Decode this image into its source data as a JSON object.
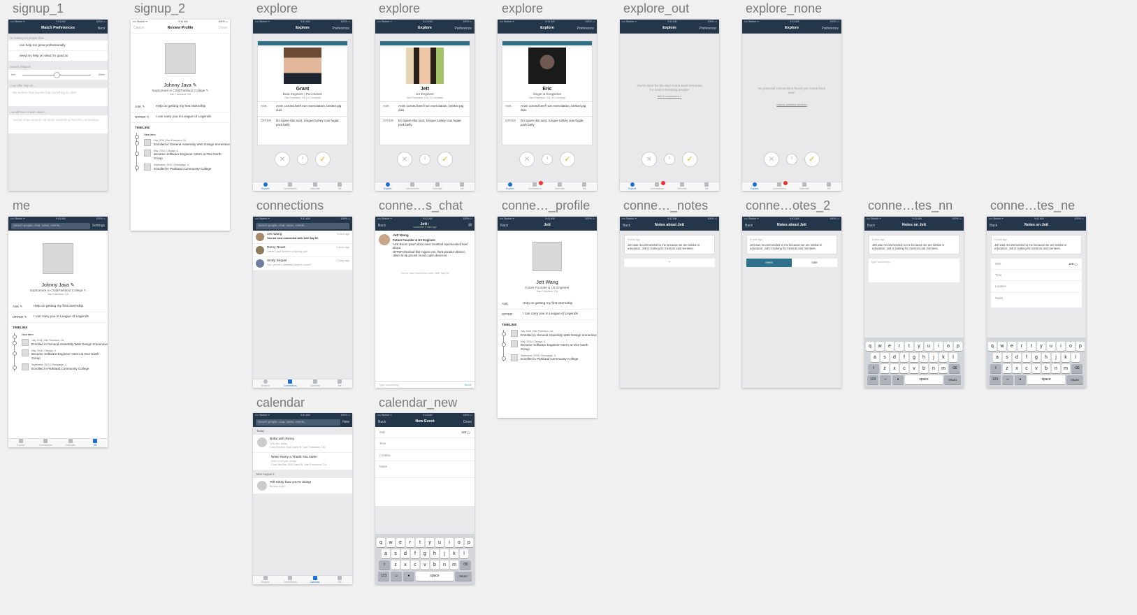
{
  "labels": {
    "signup_1": "signup_1",
    "signup_2": "signup_2",
    "explore_a": "explore",
    "explore_b": "explore",
    "explore_c": "explore",
    "explore_out": "explore_out",
    "explore_none": "explore_none",
    "me": "me",
    "connections": "connections",
    "conn_chat": "conne…s_chat",
    "conn_profile": "conne…_profile",
    "conn_notes": "conne…_notes",
    "conn_notes2": "conne…otes_2",
    "conn_nn": "conne…tes_nn",
    "conn_ne": "conne…tes_ne",
    "calendar": "calendar",
    "calendar_new": "calendar_new"
  },
  "status": {
    "carrier": "•••• Sketch ᯤ",
    "time": "9:41 AM",
    "battery": "100% ▭"
  },
  "tabs": [
    "Explore",
    "Connections",
    "Calendar",
    "Me"
  ],
  "signup1": {
    "title": "Match Preferences",
    "next": "Next",
    "looking": "I'm looking for people that...",
    "opt1": "can help me grow professionally",
    "opt2": "need my help on what I'm good at",
    "distance": "Search distance",
    "dmin": "5mi",
    "dmax": "100mi",
    "can_help": "I can offer help on...",
    "can_help_ph": "We believe that anyone has something to offer!",
    "learn": "I would love to learn about...",
    "learn_ph": "And we hope anyone can learn something from the community!"
  },
  "signup2": {
    "cancel": "Cancel",
    "title": "Review Profile",
    "done": "Done"
  },
  "profile": {
    "name": "Johnny Java ✎",
    "school": "Sophomore in CS@Parkland College ✎",
    "loc": "San Francisco, CA",
    "ask_k": "ASK ✎",
    "ask_v": "Help on getting my first internship",
    "offer_k": "OFFER ✎",
    "offer_v": "I can carry you in League of Legends",
    "timeline": "TIMELINE",
    "new": "New item",
    "t1d": "July, 2016 | San Francisco, CA",
    "t1": "Enrolled in General Assembly Web Design Immersive",
    "t2d": "May, 2016 | Chicago, IL",
    "t2": "Became Software Engineer Intern at One North Group",
    "t3d": "September, 2015 | Champaign, IL",
    "t3": "Enrolled in Parkland Community College"
  },
  "explore": {
    "title": "Explore",
    "pref": "Preference",
    "ask": "ASK",
    "offer": "OFFER",
    "ask_v": "Anim corned beef non exercitation, brisket pig duis",
    "offer_v": "Do spare ribs sunt, tongue turkey cow fugiat pork belly",
    "x": "✕",
    "i": "i",
    "ok": "✓",
    "p1": {
      "name": "Grant",
      "job": "Data Engineer | Pun Master",
      "loc": "San Francisco, CA | 4.2 mi away"
    },
    "p2": {
      "name": "Jett",
      "job": "UX Engineer",
      "loc": "San Francisco, CA | 4.2 mi away"
    },
    "p3": {
      "name": "Eric",
      "job": "Singer & Songwriter",
      "loc": "San Francisco, CA | 4.2 mi away"
    },
    "out_msg": "You're done for the day! Come back tomorrow for more interesting people!",
    "out_link": "talk to connections »",
    "none_msg": "No potential connections found yet! Come back later!",
    "none_link": "explore potential mentees"
  },
  "me": {
    "search": "Search people, chat, notes, events...",
    "settings": "Settings"
  },
  "connections": {
    "search": "Search people, chat, notes, events...",
    "items": [
      {
        "n": "Jett Wang",
        "m": "You are now connected with Jett! Say hi!",
        "t": "5 mins ago"
      },
      {
        "n": "Remy React",
        "m": "Great! Look forward to seeing you!",
        "t": "4 hours ago"
      },
      {
        "n": "Sindy Sequel",
        "m": "You: yes let's definitely keep in touch!",
        "t": "17 days ago"
      }
    ]
  },
  "chat": {
    "back": "Back",
    "title": "Jett ›",
    "sub": "connected 5 mins ago",
    "name": "Jett Wang",
    "role": "Future Founder & UX Engineer",
    "ask": "ASK Bacon ipsum dolor amet meatloaf reprehenderit beef aliqua",
    "offer": "OFFER Meatloaf filet mignon nisi, flank pariatur ullamco cillum tri-tip ground round cupim deserunt",
    "sys": "You're now connected with Jett! Say hi!",
    "type": "Type something...",
    "send": "Send"
  },
  "cprofile": {
    "back": "Back",
    "title": "Jett",
    "name": "Jett Wang",
    "role": "Future Founder & UX Engineer",
    "loc": "San Francisco, CA",
    "ask": "ASK",
    "ask_v": "Help on getting my first internship",
    "offer": "OFFER",
    "offer_v": "I can carry you in League of Legends"
  },
  "notes": {
    "back": "Back",
    "title": "Notes about Jett",
    "title2": "Notes on Jett",
    "ts": "5 mins ago",
    "text": "Jett was recommended to me because we are similar in education. Jett is looking for mentors and mentees.",
    "plus": "+",
    "event": "event",
    "note": "note",
    "type": "Type something...",
    "with": "With",
    "jett": "Jett",
    "time": "Time",
    "location": "Location",
    "notes": "Notes"
  },
  "calendar": {
    "search": "Search people, chat, notes, events...",
    "new": "New",
    "today": "Today",
    "e1": "Boba with Remy",
    "e1d": "1:00 pm, today",
    "e1l": "Cool Tea Bar, 510 Grant St, San Francisco, CA",
    "e2": "Write Remy a Thank You Note!",
    "e2d": "3:00-12:00 pm, today",
    "e2l": "Cool Tea Bar, 510 Grant St, San Francisco, CA",
    "day2": "Mon August 2",
    "e3": "Tell Sindy how you're doing!",
    "e3d": "All day, Aug 2"
  },
  "calnew": {
    "back": "Back",
    "title": "New Event",
    "done": "Done"
  },
  "kb": {
    "r1": [
      "q",
      "w",
      "e",
      "r",
      "t",
      "y",
      "u",
      "i",
      "o",
      "p"
    ],
    "r2": [
      "a",
      "s",
      "d",
      "f",
      "g",
      "h",
      "j",
      "k",
      "l"
    ],
    "r3": [
      "z",
      "x",
      "c",
      "v",
      "b",
      "n",
      "m"
    ],
    "shift": "⇧",
    "del": "⌫",
    "num": "123",
    "emoji": "☺",
    "mic": "🎤",
    "space": "space",
    "ret": "return"
  }
}
